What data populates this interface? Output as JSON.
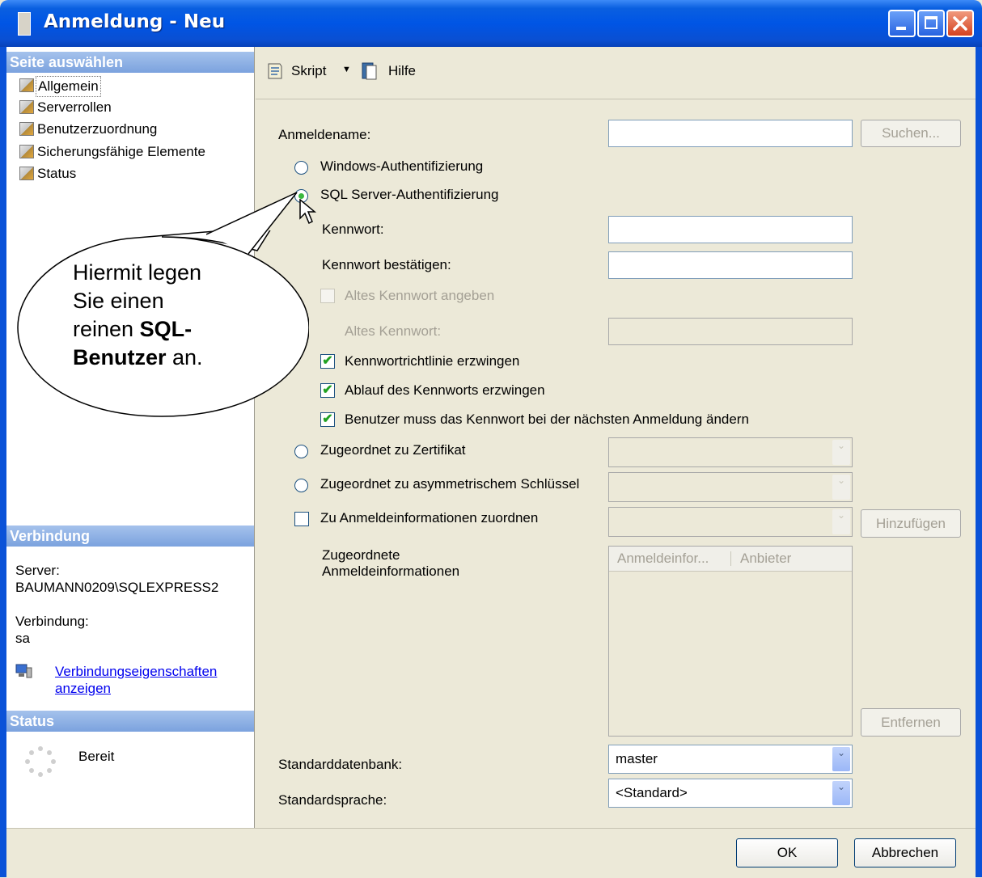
{
  "window": {
    "title": "Anmeldung - Neu"
  },
  "sidebar": {
    "header": "Seite auswählen",
    "items": [
      {
        "label": "Allgemein"
      },
      {
        "label": "Serverrollen"
      },
      {
        "label": "Benutzerzuordnung"
      },
      {
        "label": "Sicherungsfähige Elemente"
      },
      {
        "label": "Status"
      }
    ],
    "connection_header": "Verbindung",
    "server_label": "Server:",
    "server_value": "BAUMANN0209\\SQLEXPRESS2",
    "connection_label": "Verbindung:",
    "connection_value": "sa",
    "connection_link_line1": "Verbindungseigenschaften",
    "connection_link_line2": "anzeigen",
    "status_header": "Status",
    "status_value": "Bereit"
  },
  "toolbar": {
    "script_label": "Skript",
    "help_label": "Hilfe"
  },
  "form": {
    "login_name_label": "Anmeldename:",
    "login_name_value": "",
    "search_button": "Suchen...",
    "windows_auth": "Windows-Authentifizierung",
    "sql_auth": "SQL Server-Authentifizierung",
    "password_label": "Kennwort:",
    "confirm_password_label": "Kennwort bestätigen:",
    "specify_old_password": "Altes Kennwort angeben",
    "old_password_label": "Altes Kennwort:",
    "enforce_policy": "Kennwortrichtlinie erzwingen",
    "enforce_expiration": "Ablauf des Kennworts erzwingen",
    "must_change": "Benutzer muss das Kennwort bei der nächsten Anmeldung ändern",
    "mapped_certificate": "Zugeordnet zu Zertifikat",
    "mapped_asymmetric_key": "Zugeordnet zu asymmetrischem Schlüssel",
    "map_credentials": "Zu Anmeldeinformationen zuordnen",
    "add_button": "Hinzufügen",
    "mapped_credentials_line1": "Zugeordnete",
    "mapped_credentials_line2": "Anmeldeinformationen",
    "grid_col1": "Anmeldeinfor...",
    "grid_col2": "Anbieter",
    "remove_button": "Entfernen",
    "default_db_label": "Standarddatenbank:",
    "default_db_value": "master",
    "default_lang_label": "Standardsprache:",
    "default_lang_value": "<Standard>"
  },
  "buttons": {
    "ok": "OK",
    "cancel": "Abbrechen"
  },
  "callout": {
    "line1": "Hiermit legen",
    "line2": "Sie einen",
    "line3_pre": "reinen ",
    "line3_bold": "SQL-",
    "line4_bold": "Benutzer",
    "line4_post": " an."
  }
}
